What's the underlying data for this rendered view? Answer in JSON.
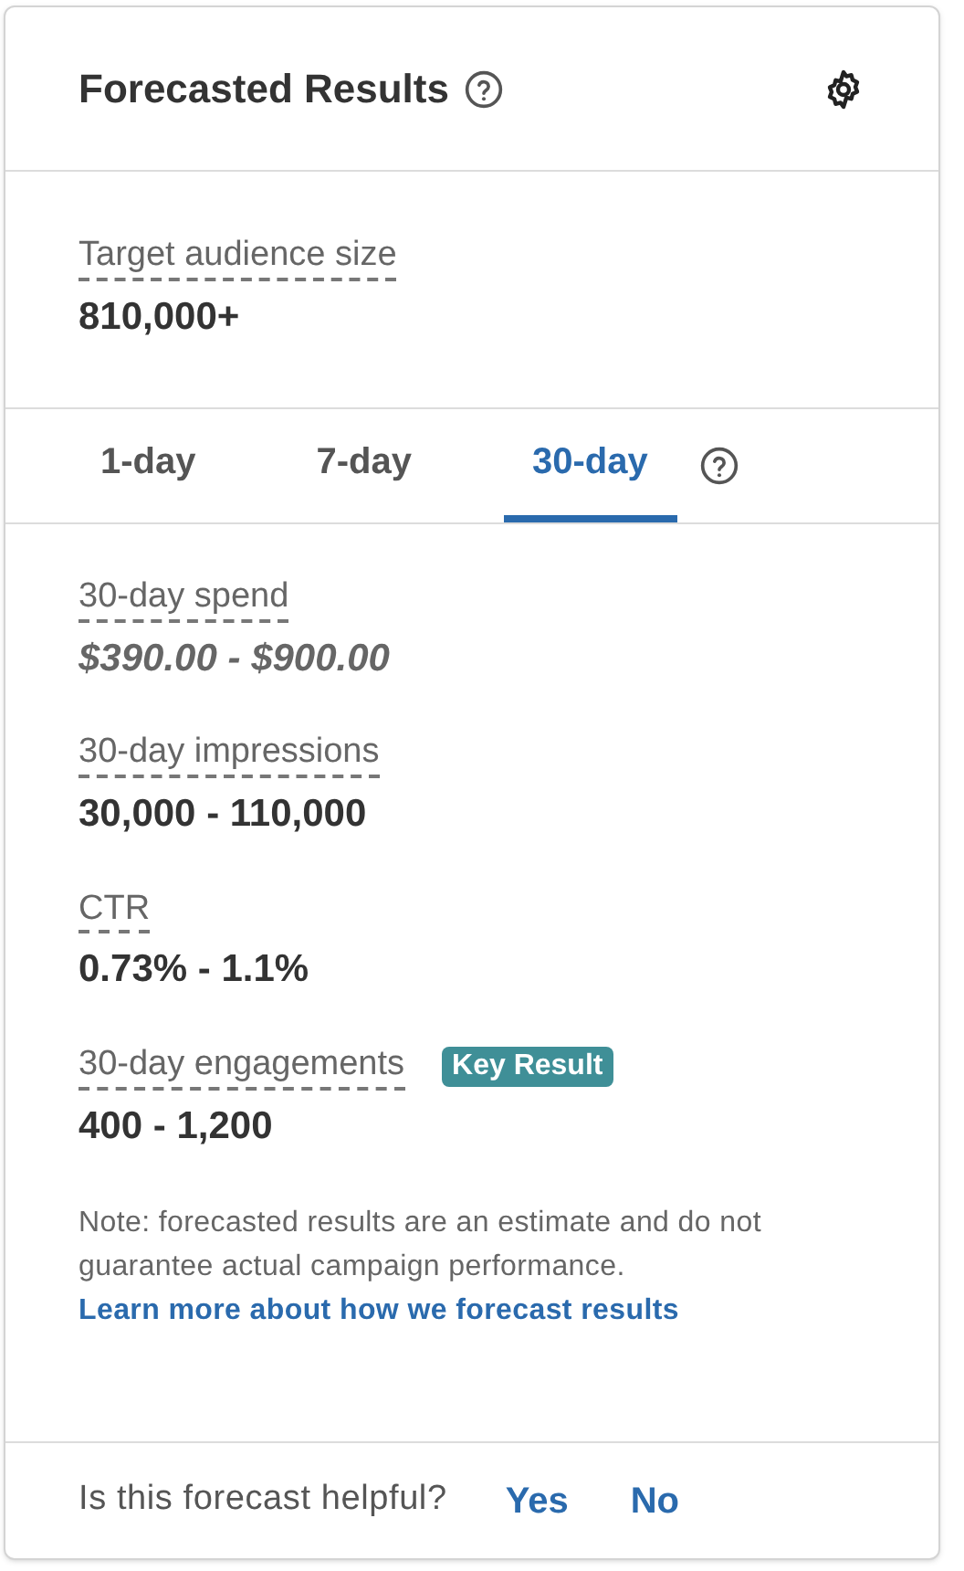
{
  "header": {
    "title": "Forecasted Results"
  },
  "audience": {
    "label": "Target audience size",
    "value": "810,000+"
  },
  "tabs": [
    {
      "label": "1-day",
      "selected": false
    },
    {
      "label": "7-day",
      "selected": false
    },
    {
      "label": "30-day",
      "selected": true
    }
  ],
  "metrics": [
    {
      "label": "30-day spend",
      "value": "$390.00 - $900.00",
      "kind": "estimate"
    },
    {
      "label": "30-day impressions",
      "value": "30,000 - 110,000",
      "kind": "count"
    },
    {
      "label": "CTR",
      "value": "0.73% - 1.1%",
      "kind": "count"
    },
    {
      "label": "30-day engagements",
      "value": "400 - 1,200",
      "kind": "count",
      "badge": "Key Result"
    }
  ],
  "note": {
    "text": "Note: forecasted results are an estimate and do not guarantee actual campaign performance.",
    "link": "Learn more about how we forecast results"
  },
  "feedback": {
    "question": "Is this forecast helpful?",
    "options": [
      "Yes",
      "No"
    ]
  }
}
